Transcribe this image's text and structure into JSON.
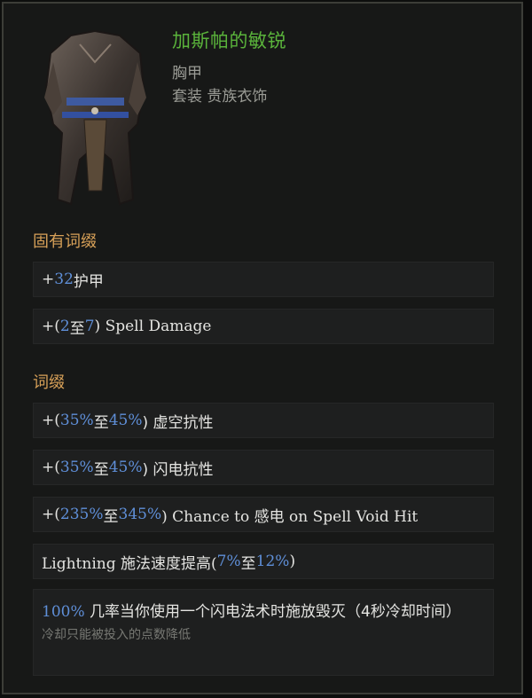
{
  "item": {
    "name": "加斯帕的敏锐",
    "slot": "胸甲",
    "set_label": "套装 贵族衣饰",
    "name_color": "#5ab33b"
  },
  "sections": {
    "implicit_title": "固有词缀",
    "affix_title": "词缀"
  },
  "implicits": [
    {
      "pre": "+",
      "value": "32",
      "post": " 护甲"
    },
    {
      "pre": "+(",
      "v1": "2",
      "mid": " 至 ",
      "v2": "7",
      "post": ") Spell Damage"
    }
  ],
  "affixes": [
    {
      "pre": "+(",
      "v1": "35%",
      "mid": " 至 ",
      "v2": "45%",
      "post": ") 虚空抗性"
    },
    {
      "pre": "+(",
      "v1": "35%",
      "mid": " 至 ",
      "v2": "45%",
      "post": ") 闪电抗性"
    },
    {
      "pre": "+(",
      "v1": "235%",
      "mid": " 至 ",
      "v2": "345%",
      "post": ") Chance to 感电 on Spell Void Hit"
    },
    {
      "pre": "Lightning 施法速度提高(",
      "v1": "7%",
      "mid": " 至 ",
      "v2": "12%",
      "post": ")"
    }
  ],
  "special": {
    "value": "100%",
    "text": " 几率当你使用一个闪电法术时施放毁灭（4秒冷却时间）",
    "note": "冷却只能被投入的点数降低"
  },
  "icons": {
    "armor": "chest-armor-icon"
  }
}
